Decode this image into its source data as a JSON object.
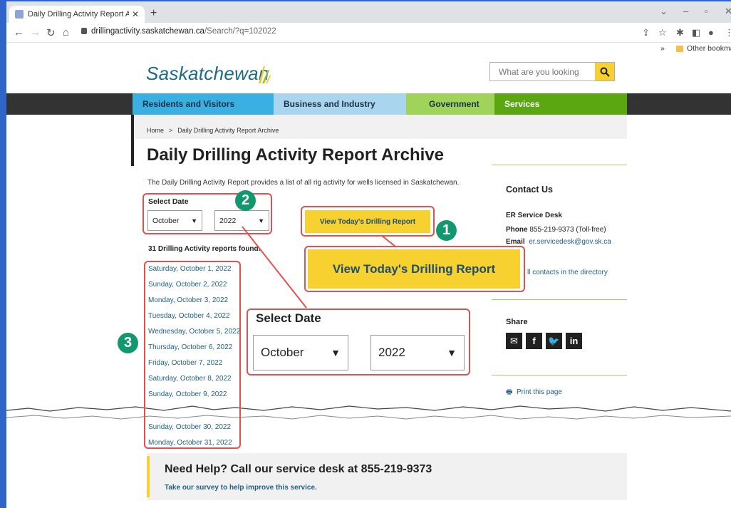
{
  "browser": {
    "tab_title": "Daily Drilling Activity Report Arc",
    "new_tab": "+",
    "url_host": "drillingactivity.saskatchewan.ca",
    "url_path": "/Search/?q=102022",
    "bookmarks_chevron": "»",
    "other_bookmarks": "Other bookmarks"
  },
  "header": {
    "logo_text": "Saskatchewan",
    "search_placeholder": "What are you looking for?"
  },
  "nav": {
    "items": [
      {
        "label": "Residents and Visitors",
        "color": "#3ab0e2",
        "text_color": "#1b2f45"
      },
      {
        "label": "Business and Industry",
        "color": "#a9d5ee",
        "text_color": "#1b2f45"
      },
      {
        "label": "Government",
        "color": "#9fd35a",
        "text_color": "#1b2f45"
      },
      {
        "label": "Services",
        "color": "#5aa712",
        "text_color": "#ffffff"
      }
    ]
  },
  "breadcrumb": {
    "home": "Home",
    "separator": ">",
    "current": "Daily Drilling Activity Report Archive"
  },
  "main": {
    "title": "Daily Drilling Activity Report Archive",
    "intro": "The Daily Drilling Activity Report provides a list of all rig activity for wells licensed in Saskatchewan.",
    "select_label": "Select Date",
    "month_value": "October",
    "year_value": "2022",
    "found_text": "31 Drilling Activity reports found.",
    "view_button": "View Today's Drilling Report",
    "dates": [
      "Saturday, October 1, 2022",
      "Sunday, October 2, 2022",
      "Monday, October 3, 2022",
      "Tuesday, October 4, 2022",
      "Wednesday, October 5, 2022",
      "Thursday, October 6, 2022",
      "Friday, October 7, 2022",
      "Saturday, October 8, 2022",
      "Sunday, October 9, 2022",
      "Sunday, October 30, 2022",
      "Monday, October 31, 2022"
    ]
  },
  "sidebar": {
    "contact_heading": "Contact Us",
    "desk_name": "ER Service Desk",
    "phone_label": "Phone",
    "phone_value": "855-219-9373 (Toll-free)",
    "email_label": "Email",
    "email_value": "er.servicedesk@gov.sk.ca",
    "all_contacts": "ll contacts in the directory",
    "share_heading": "Share",
    "share_icons": [
      "email-icon",
      "facebook-icon",
      "twitter-icon",
      "linkedin-icon"
    ],
    "print_label": "Print this page"
  },
  "help": {
    "title": "Need Help? Call our service desk at 855-219-9373",
    "survey_link": "Take our survey to help improve this service."
  },
  "annotations": {
    "badge_1": "1",
    "badge_2": "2",
    "badge_3": "3",
    "callout_color": "#e2514e",
    "badge_color": "#12986f"
  }
}
